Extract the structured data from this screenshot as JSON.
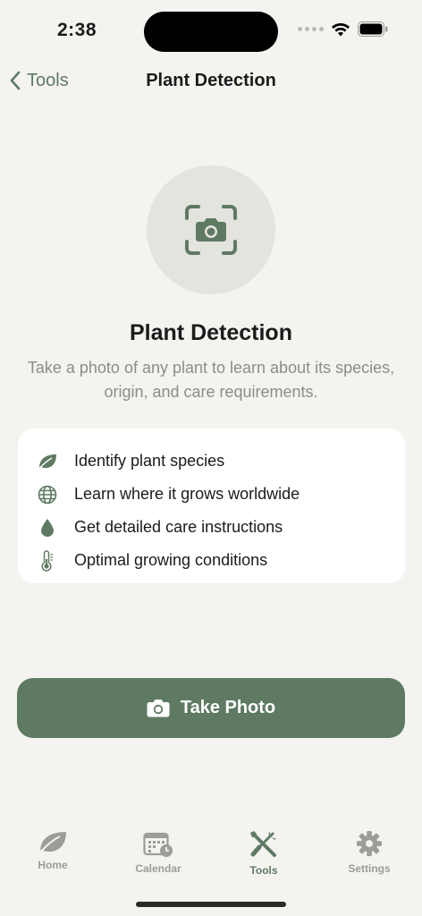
{
  "status_bar": {
    "time": "2:38"
  },
  "nav": {
    "back_label": "Tools",
    "title": "Plant Detection"
  },
  "hero": {
    "title": "Plant Detection",
    "description": "Take a photo of any plant to learn about its species, origin, and care requirements."
  },
  "features": [
    {
      "icon": "leaf-icon",
      "label": "Identify plant species"
    },
    {
      "icon": "globe-icon",
      "label": "Learn where it grows worldwide"
    },
    {
      "icon": "water-drop-icon",
      "label": "Get detailed care instructions"
    },
    {
      "icon": "thermometer-icon",
      "label": "Optimal growing conditions"
    }
  ],
  "action": {
    "label": "Take Photo",
    "icon": "camera-icon"
  },
  "tabs": [
    {
      "label": "Home",
      "icon": "leaf-icon",
      "active": false
    },
    {
      "label": "Calendar",
      "icon": "calendar-icon",
      "active": false
    },
    {
      "label": "Tools",
      "icon": "tools-icon",
      "active": true
    },
    {
      "label": "Settings",
      "icon": "gear-icon",
      "active": false
    }
  ],
  "colors": {
    "accent": "#5f7a63",
    "background": "#f4f3ef",
    "card": "#ffffff",
    "muted_text": "#8c8c88",
    "inactive_tab": "#9c9c98"
  }
}
